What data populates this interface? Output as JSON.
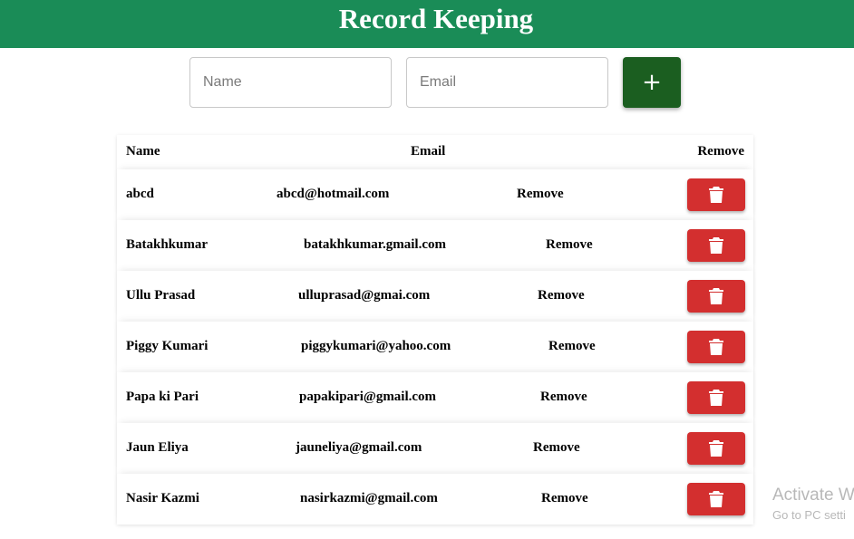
{
  "header": {
    "title": "Record Keeping"
  },
  "form": {
    "name_placeholder": "Name",
    "email_placeholder": "Email",
    "name_value": "",
    "email_value": "",
    "add_label": "+"
  },
  "table": {
    "columns": [
      "Name",
      "Email",
      "Remove"
    ],
    "rows": [
      {
        "name": "abcd",
        "email": "abcd@hotmail.com",
        "remove": "Remove"
      },
      {
        "name": "Batakhkumar",
        "email": "batakhkumar.gmail.com",
        "remove": "Remove"
      },
      {
        "name": "Ullu Prasad",
        "email": "ulluprasad@gmai.com",
        "remove": "Remove"
      },
      {
        "name": "Piggy Kumari",
        "email": "piggykumari@yahoo.com",
        "remove": "Remove"
      },
      {
        "name": "Papa ki Pari",
        "email": "papakipari@gmail.com",
        "remove": "Remove"
      },
      {
        "name": "Jaun Eliya",
        "email": "jauneliya@gmail.com",
        "remove": "Remove"
      },
      {
        "name": "Nasir Kazmi",
        "email": "nasirkazmi@gmail.com",
        "remove": "Remove"
      }
    ],
    "row_icon": "trash-icon"
  },
  "watermark": {
    "title": "Activate W",
    "subtitle": "Go to PC setti"
  },
  "colors": {
    "header_bg": "#1a8c57",
    "add_button": "#1b5e20",
    "delete_button": "#d32f2f"
  }
}
